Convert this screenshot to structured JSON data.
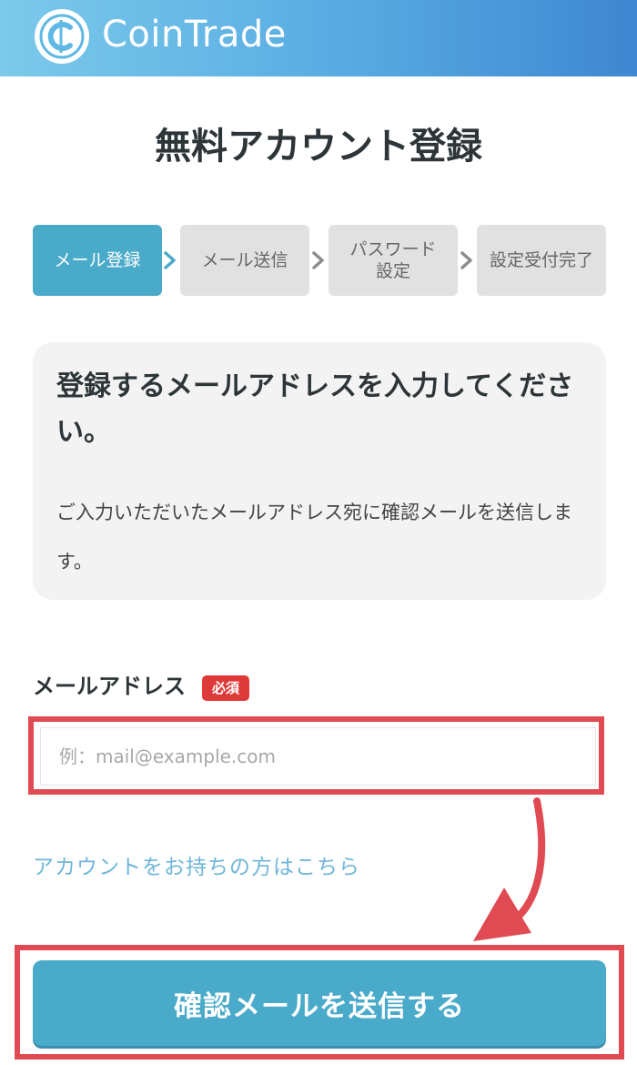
{
  "header": {
    "brand": "CoinTrade",
    "logo_icon": "coin-c-icon",
    "colors": {
      "gradient_start": "#7cc9ea",
      "gradient_end": "#3f87d1"
    }
  },
  "page_title": "無料アカウント登録",
  "steps": {
    "items": [
      {
        "label": "メール登録",
        "active": true
      },
      {
        "label": "メール送信",
        "active": false
      },
      {
        "label": "パスワード設定",
        "active": false
      },
      {
        "label": "設定受付完了",
        "active": false
      }
    ],
    "arrow_icon": "chevron-right-icon"
  },
  "info": {
    "heading": "登録するメールアドレスを入力してください。",
    "body": "ご入力いただいたメールアドレス宛に確認メールを送信します。"
  },
  "form": {
    "email_label": "メールアドレス",
    "required_badge": "必須",
    "email_placeholder": "例：mail@example.com",
    "email_value": "",
    "login_link": "アカウントをお持ちの方はこちら",
    "submit": "確認メールを送信する"
  },
  "colors": {
    "accent": "#4aaac9",
    "highlight": "#e04a52",
    "required": "#df3a3a",
    "link": "#6fb6d8"
  }
}
